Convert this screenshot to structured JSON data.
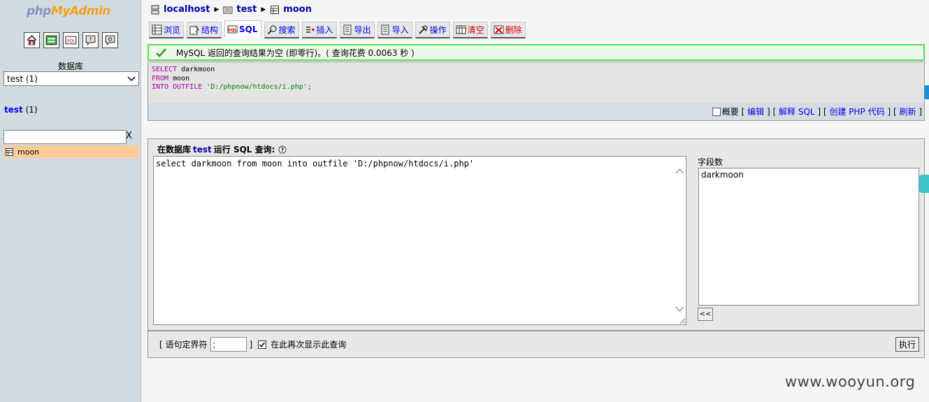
{
  "nav": {
    "logo_php": "php",
    "logo_myadmin": "MyAdmin",
    "icons": [
      "home-icon",
      "sql-window-icon",
      "sql-docs-icon",
      "docs-icon",
      "query-window-icon"
    ],
    "db_label": "数据库",
    "db_selected": "test (1)",
    "db_title": "test",
    "db_count": "(1)",
    "filter_value": "",
    "filter_clear": "X",
    "tables": [
      {
        "name": "moon",
        "icon": "table-icon"
      }
    ]
  },
  "breadcrumb": {
    "server": "localhost",
    "database": "test",
    "table": "moon"
  },
  "tabs": [
    {
      "label": "浏览",
      "icon": "browse-icon"
    },
    {
      "label": "结构",
      "icon": "structure-icon"
    },
    {
      "label": "SQL",
      "icon": "sql-icon",
      "active": true
    },
    {
      "label": "搜索",
      "icon": "search-icon"
    },
    {
      "label": "插入",
      "icon": "insert-icon"
    },
    {
      "label": "导出",
      "icon": "export-icon"
    },
    {
      "label": "导入",
      "icon": "import-icon"
    },
    {
      "label": "操作",
      "icon": "operations-icon"
    },
    {
      "label": "清空",
      "icon": "empty-icon",
      "danger": true
    },
    {
      "label": "删除",
      "icon": "drop-icon",
      "danger": true
    }
  ],
  "message": {
    "text": "MySQL 返回的查询结果为空 (即零行)。( 查询花费 0.0063 秒 )",
    "color": "#55dd55"
  },
  "executed_sql": {
    "line1_kw": "SELECT",
    "line1_rest": "darkmoon",
    "line2_kw": "FROM",
    "line2_rest": "moon",
    "line3_kw": "INTO OUTFILE",
    "line3_str": "'D:/phpnow/htdocs/i.php'",
    "line3_end": ";"
  },
  "sql_actions": {
    "profiling": "概要",
    "open_bracket": "[",
    "close_bracket": "]",
    "edit": "编辑",
    "explain": "解释 SQL",
    "create_php": "创建 PHP 代码",
    "refresh": "刷新"
  },
  "query_form": {
    "legend_prefix": "在数据库",
    "legend_db": "test",
    "legend_suffix": "运行 SQL 查询:",
    "query_text": "select darkmoon from moon into outfile 'D:/phpnow/htdocs/i.php'",
    "fields_label": "字段数",
    "fields": [
      "darkmoon"
    ],
    "insert_button": "<<",
    "delimiter_open": "[ 语句定界符",
    "delimiter_value": ";",
    "delimiter_close": "]",
    "show_again_label": "在此再次显示此查询",
    "show_again_checked": true,
    "go_button": "执行"
  },
  "watermark": "www.wooyun.org"
}
